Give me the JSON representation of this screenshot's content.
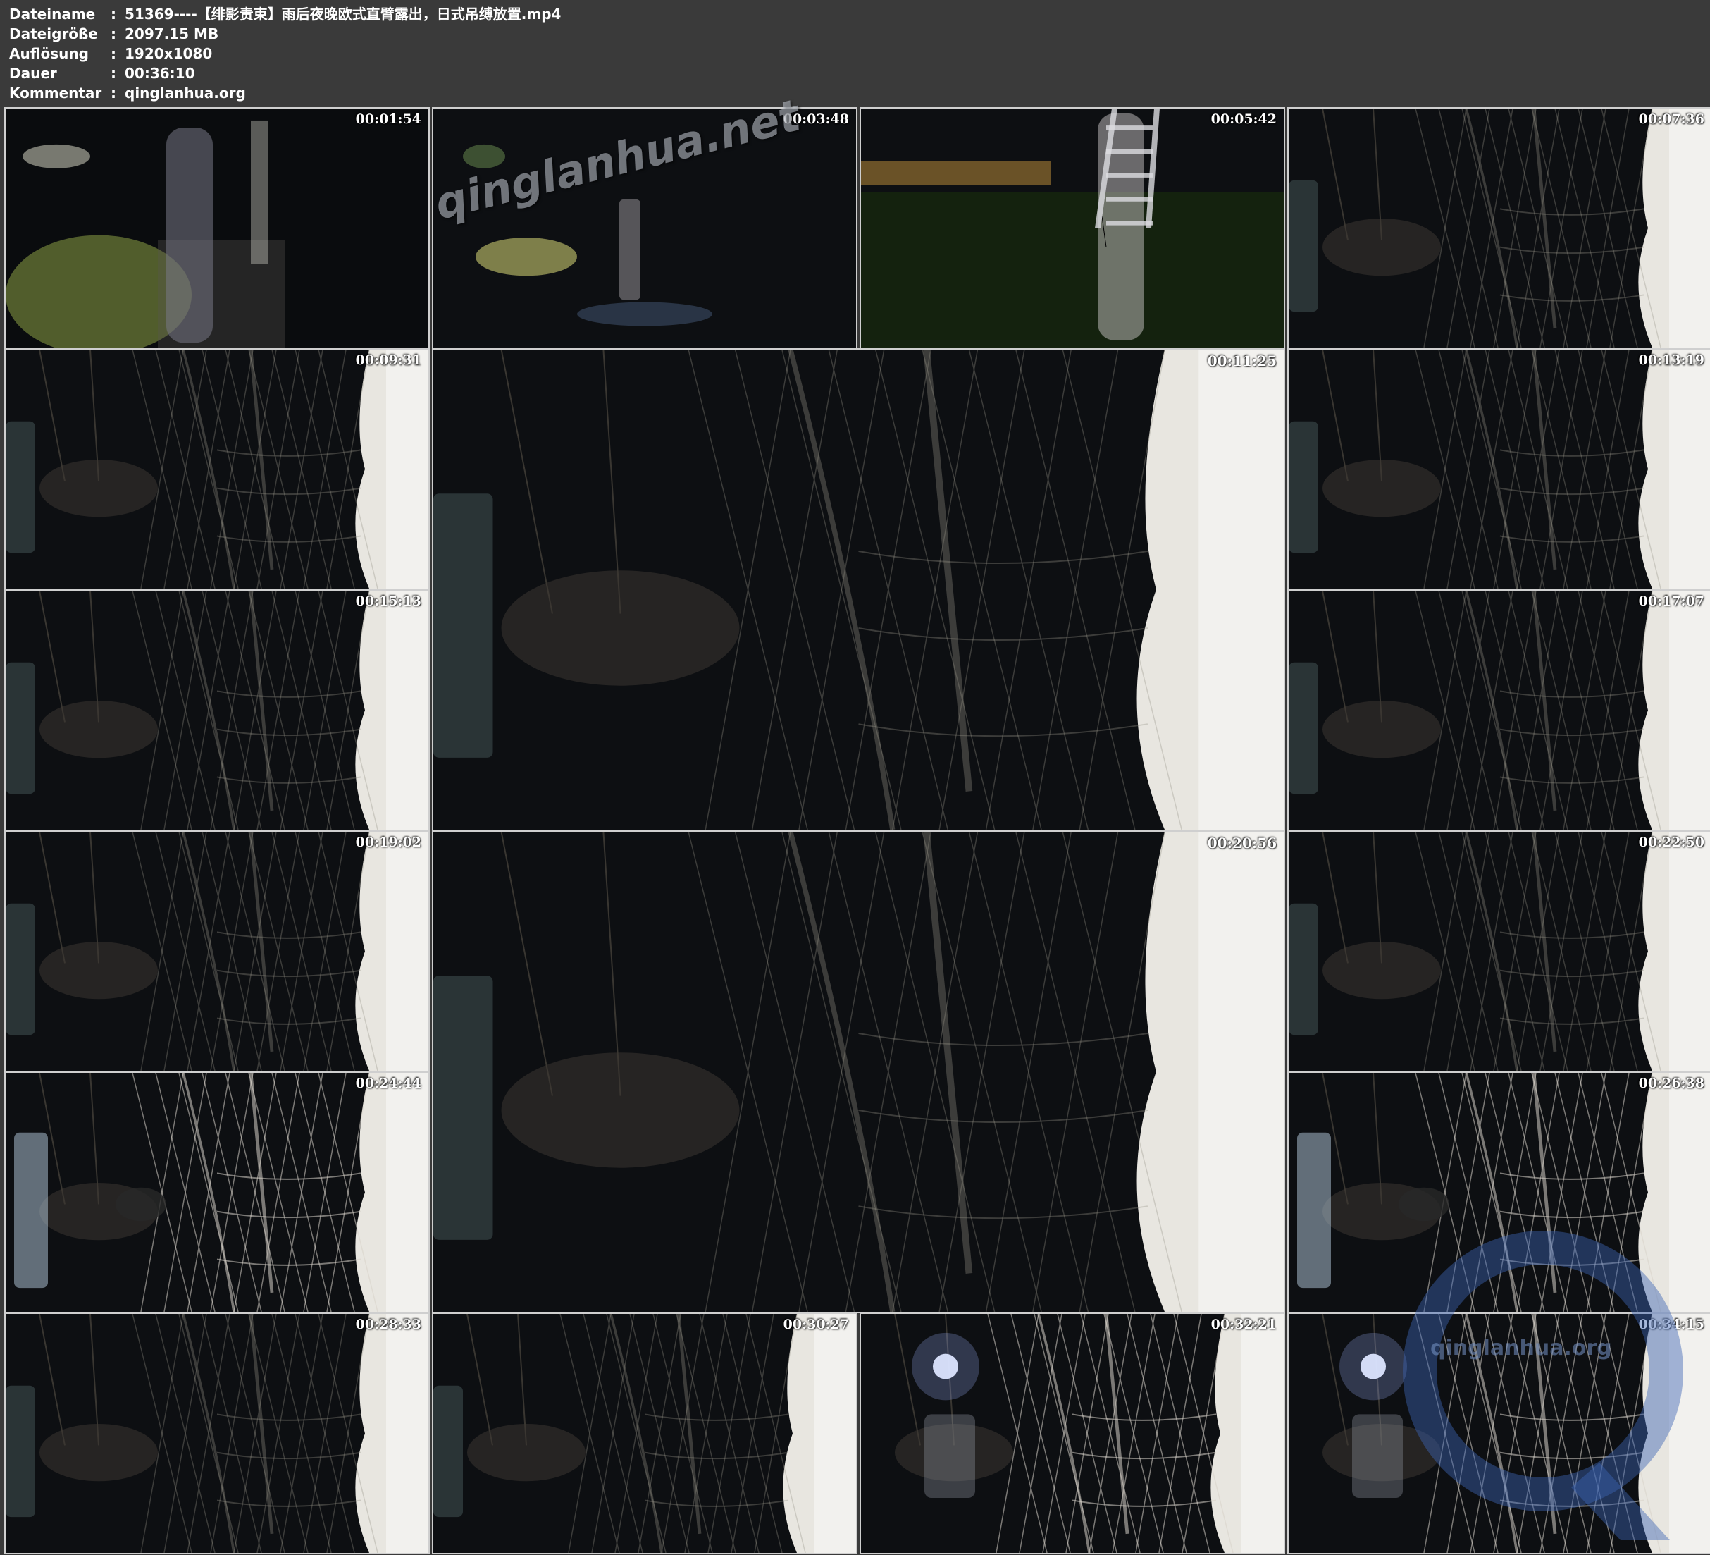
{
  "file_info": [
    {
      "key": "Dateiname",
      "value": "51369----【绯影责束】雨后夜晚欧式直臂露出，日式吊缚放置.mp4"
    },
    {
      "key": "Dateigröße",
      "value": "2097.15 MB"
    },
    {
      "key": "Auflösung",
      "value": "1920x1080"
    },
    {
      "key": "Dauer",
      "value": "00:36:10"
    },
    {
      "key": "Kommentar",
      "value": "qinglanhua.org"
    }
  ],
  "separator": ":",
  "thumbnails": [
    {
      "timestamp": "00:01:54",
      "scene": "night-path-standing"
    },
    {
      "timestamp": "00:03:48",
      "scene": "night-path-far"
    },
    {
      "timestamp": "00:05:42",
      "scene": "lawn-ladder-standing"
    },
    {
      "timestamp": "00:07:36",
      "scene": "net-frame-dark"
    },
    {
      "timestamp": "00:09:31",
      "scene": "net-frame-dark"
    },
    {
      "timestamp": "00:11:25",
      "scene": "net-frame-large"
    },
    {
      "timestamp": "00:13:19",
      "scene": "net-frame-dark"
    },
    {
      "timestamp": "00:15:13",
      "scene": "net-frame-dark"
    },
    {
      "timestamp": "00:17:07",
      "scene": "net-frame-dark"
    },
    {
      "timestamp": "00:19:02",
      "scene": "net-frame-dark"
    },
    {
      "timestamp": "00:20:56",
      "scene": "net-frame-large"
    },
    {
      "timestamp": "00:22:50",
      "scene": "net-frame-dark"
    },
    {
      "timestamp": "00:24:44",
      "scene": "net-frame-lit"
    },
    {
      "timestamp": "00:26:38",
      "scene": "net-frame-lit"
    },
    {
      "timestamp": "00:28:33",
      "scene": "net-frame-dark"
    },
    {
      "timestamp": "00:30:27",
      "scene": "net-frame-dark"
    },
    {
      "timestamp": "00:32:21",
      "scene": "net-frame-lamp"
    },
    {
      "timestamp": "00:34:15",
      "scene": "net-frame-lamp"
    }
  ],
  "watermarks": {
    "text": "qinglanhua.net",
    "logo_text": "qinglanhua.org",
    "logo_color": "#3c64b4"
  },
  "colors": {
    "background": "#3a3a3a",
    "thumb_border": "#cfcfcf",
    "text": "#ffffff"
  }
}
